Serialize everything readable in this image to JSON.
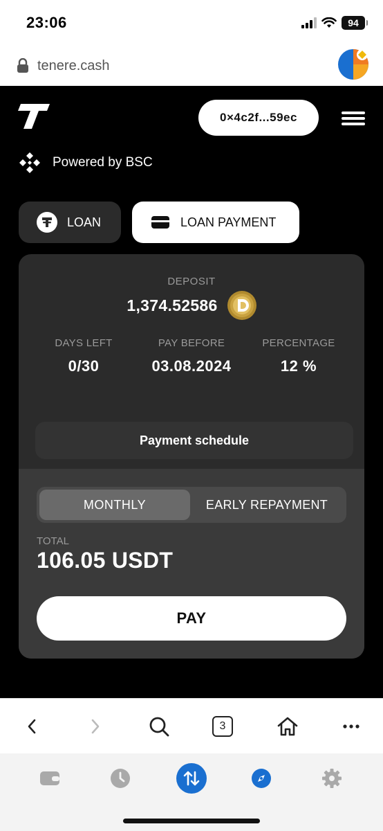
{
  "status_bar": {
    "time": "23:06",
    "battery": "94"
  },
  "browser": {
    "url": "tenere.cash"
  },
  "header": {
    "wallet_address": "0×4c2f...59ec",
    "powered_by": "Powered by BSC"
  },
  "tabs": {
    "loan": "LOAN",
    "loan_payment": "LOAN PAYMENT",
    "active": "loan_payment"
  },
  "card": {
    "deposit_label": "DEPOSIT",
    "deposit_value": "1,374.52586",
    "stats": {
      "days_left_label": "DAYS LEFT",
      "days_left_value": "0/30",
      "pay_before_label": "PAY BEFORE",
      "pay_before_value": "03.08.2024",
      "percentage_label": "PERCENTAGE",
      "percentage_value": "12 %"
    },
    "schedule_button": "Payment schedule",
    "segment": {
      "monthly": "MONTHLY",
      "early": "EARLY REPAYMENT",
      "active": "monthly"
    },
    "total_label": "TOTAL",
    "total_value": "106.05 USDT",
    "pay_button": "PAY"
  },
  "browser_nav": {
    "tabs_count": "3"
  },
  "colors": {
    "app_bg": "#000000",
    "card_bg": "#2b2b2b",
    "lower_bg": "#3a3a3a",
    "accent_blue": "#1a6fd0",
    "coin_gold": "#b08a2e"
  },
  "icons": {
    "browser_nav": [
      "back-icon",
      "forward-icon",
      "search-icon",
      "tabs-icon",
      "home-icon",
      "more-icon"
    ],
    "wallet_bar": [
      "wallet-icon",
      "history-icon",
      "swap-icon",
      "discover-icon",
      "settings-icon"
    ]
  }
}
